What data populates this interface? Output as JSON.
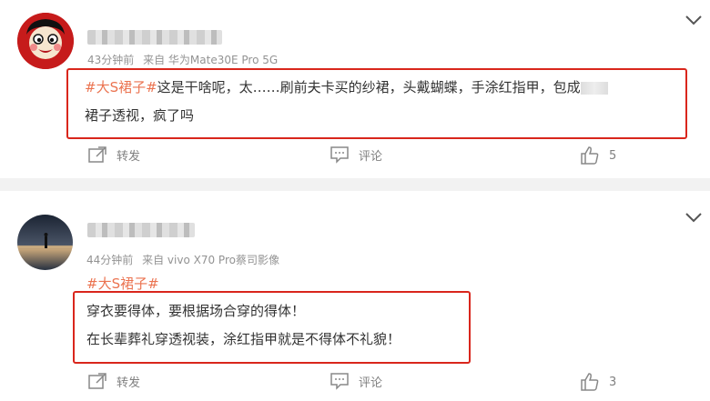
{
  "posts": [
    {
      "time": "43分钟前",
      "source": "来自 华为Mate30E Pro 5G",
      "hashtag": "#大S裙子#",
      "line1": "这是干啥呢，太……刷前夫卡买的纱裙，头戴蝴蝶，手涂红指甲，包成",
      "line2": "裙子透视，疯了吗",
      "actions": {
        "repost": "转发",
        "comment": "评论",
        "like_count": "5"
      }
    },
    {
      "time": "44分钟前",
      "source": "来自 vivo X70 Pro蔡司影像",
      "hashtag": "#大S裙子#",
      "line1": "穿衣要得体，要根据场合穿的得体！",
      "line2": "在长辈葬礼穿透视装，涂红指甲就是不得体不礼貌！",
      "actions": {
        "repost": "转发",
        "comment": "评论",
        "like_count": "3"
      }
    }
  ],
  "icons": {
    "repost": "share-icon",
    "comment": "comment-icon",
    "like": "thumbs-up-icon",
    "more": "chevron-down-icon"
  },
  "colors": {
    "hashtag": "#eb7350",
    "highlight_box": "#d9261c",
    "divider": "#f2f2f2"
  }
}
